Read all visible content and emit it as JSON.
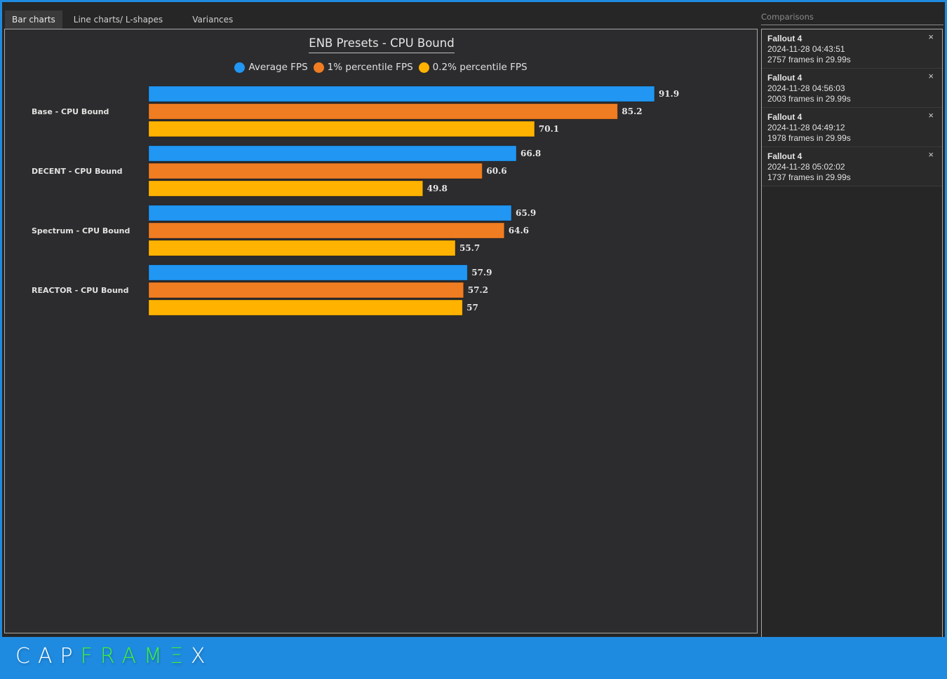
{
  "tabs": [
    {
      "label": "Bar charts",
      "active": true
    },
    {
      "label": "Line charts/ L-shapes",
      "active": false
    },
    {
      "label": "Variances",
      "active": false
    }
  ],
  "sidebar": {
    "header": "Comparisons",
    "items": [
      {
        "title": "Fallout 4",
        "datetime": "2024-11-28 04:43:51",
        "frames": "2757 frames in 29.99s",
        "close_icon": "×"
      },
      {
        "title": "Fallout 4",
        "datetime": "2024-11-28 04:56:03",
        "frames": "2003 frames in 29.99s",
        "close_icon": "×"
      },
      {
        "title": "Fallout 4",
        "datetime": "2024-11-28 04:49:12",
        "frames": "1978 frames in 29.99s",
        "close_icon": "×"
      },
      {
        "title": "Fallout 4",
        "datetime": "2024-11-28 05:02:02",
        "frames": "1737 frames in 29.99s",
        "close_icon": "×"
      }
    ]
  },
  "footer": {
    "logo_white_1": "CAP",
    "logo_green": "FRAM",
    "logo_green_2": "Ξ",
    "logo_white_2": "X"
  },
  "colors": {
    "accent": "#1f8be0",
    "avg": "#2196f3",
    "p1": "#f07d22",
    "p02": "#ffb300",
    "logo_green": "#3cf03c"
  },
  "chart_data": {
    "type": "bar",
    "orientation": "horizontal",
    "title": "ENB Presets - CPU Bound",
    "categories": [
      "Base - CPU Bound",
      "DECENT - CPU Bound",
      "Spectrum - CPU Bound",
      "REACTOR - CPU Bound"
    ],
    "series": [
      {
        "name": "Average FPS",
        "color": "#2196f3",
        "values": [
          91.9,
          66.8,
          65.9,
          57.9
        ]
      },
      {
        "name": "1% percentile FPS",
        "color": "#f07d22",
        "values": [
          85.2,
          60.6,
          64.6,
          57.2
        ]
      },
      {
        "name": "0.2% percentile FPS",
        "color": "#ffb300",
        "values": [
          70.1,
          49.8,
          55.7,
          57
        ]
      }
    ],
    "value_labels": [
      [
        "91.9",
        "85.2",
        "70.1"
      ],
      [
        "66.8",
        "60.6",
        "49.8"
      ],
      [
        "65.9",
        "64.6",
        "55.7"
      ],
      [
        "57.9",
        "57.2",
        "57"
      ]
    ],
    "xlim": [
      0,
      110
    ],
    "legend": "top-center",
    "grid": false,
    "xlabel": "",
    "ylabel": ""
  }
}
